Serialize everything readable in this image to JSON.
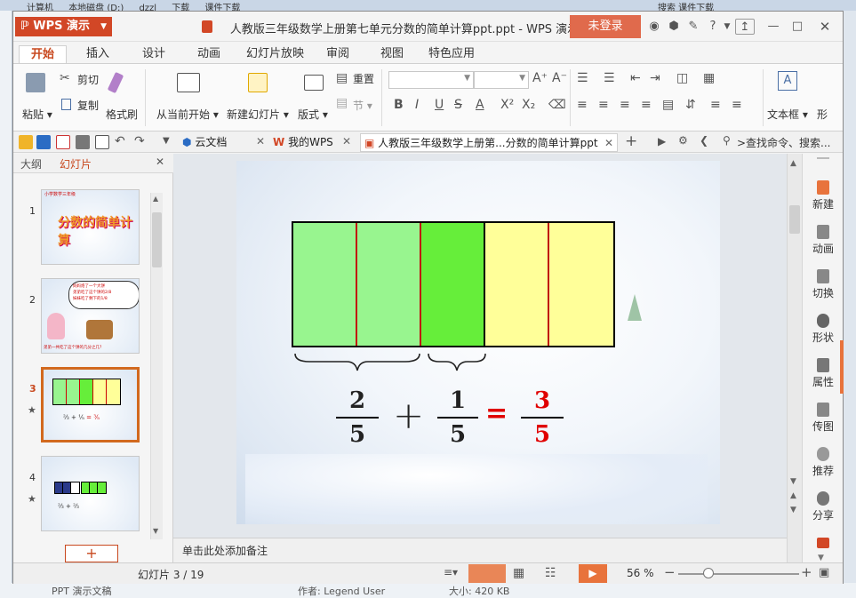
{
  "background": {
    "top_crumbs": [
      "计算机",
      "本地磁盘 (D:)",
      "dzzl",
      "下载",
      "课件下载"
    ],
    "search_placeholder": "搜索 课件下载",
    "bottom": {
      "filetype": "PPT 演示文稿",
      "author": "作者: Legend User",
      "size": "大小: 420 KB"
    }
  },
  "window": {
    "app_name": "WPS 演示",
    "title": "人教版三年级数学上册第七单元分数的简单计算ppt.ppt - WPS 演示",
    "login_label": "未登录"
  },
  "menu_tabs": [
    "开始",
    "插入",
    "设计",
    "动画",
    "幻灯片放映",
    "审阅",
    "视图",
    "特色应用"
  ],
  "ribbon": {
    "paste": "粘贴",
    "cut": "剪切",
    "copy": "复制",
    "format_painter": "格式刷",
    "from_current": "从当前开始",
    "new_slide": "新建幻灯片",
    "layout": "版式",
    "reset": "重置",
    "section": "节",
    "textbox": "文本框",
    "shape": "形"
  },
  "doc_tabs": {
    "cloud": "云文档",
    "mywps": "我的WPS",
    "current": "人教版三年级数学上册第...分数的简单计算ppt",
    "search": ">查找命令、搜索..."
  },
  "left_pane": {
    "tab_outline": "大纲",
    "tab_slides": "幻灯片",
    "slides": [
      {
        "number": "1",
        "caption": "小学数学三年级",
        "title": "分数的简单计算"
      },
      {
        "number": "2",
        "bubble": [
          "妈妈烙了一个大饼",
          "弟弟吃了这个饼的2/8",
          "妹妹吃了剩下的1/8"
        ],
        "question": "弟弟一共吃了这个饼的几分之几？"
      },
      {
        "number": "3"
      },
      {
        "number": "4"
      }
    ],
    "add_label": "+"
  },
  "slide": {
    "boxes": [
      {
        "state": "shaded"
      },
      {
        "state": "shaded"
      },
      {
        "state": "highlight"
      },
      {
        "state": "plain"
      },
      {
        "state": "plain"
      }
    ],
    "colors": {
      "shaded": "#98f58f",
      "highlight": "#66ee3a",
      "plain": "#ffff99",
      "answer": "#e00000"
    },
    "equation": {
      "a_num": "2",
      "a_den": "5",
      "plus": "+",
      "b_num": "1",
      "b_den": "5",
      "equals": "=",
      "c_num": "3",
      "c_den": "5"
    }
  },
  "notes_placeholder": "单击此处添加备注",
  "right_bar": [
    "新建",
    "动画",
    "切换",
    "形状",
    "属性",
    "传图",
    "推荐",
    "分享"
  ],
  "status": {
    "slide_counter": "幻灯片 3 / 19",
    "zoom": "56 %"
  }
}
